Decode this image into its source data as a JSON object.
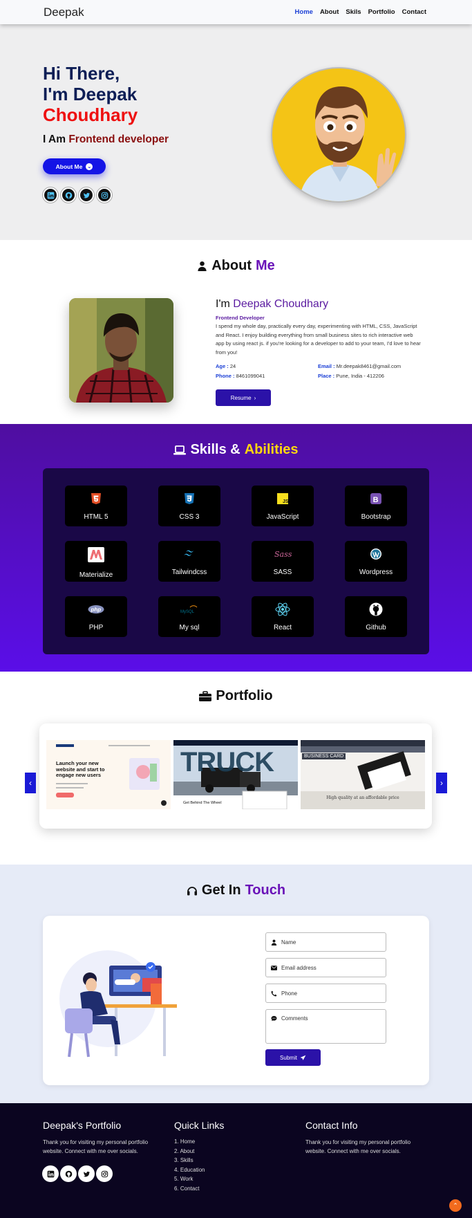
{
  "nav": {
    "brand": "Deepak",
    "links": [
      "Home",
      "About",
      "Skils",
      "Portfolio",
      "Contact"
    ],
    "active": "Home"
  },
  "hero": {
    "line1": "Hi There,",
    "line2": "I'm Deepak",
    "line3": "Choudhary",
    "subtitle_prefix": "I Am ",
    "subtitle_role": "Frontend developer",
    "button_label": "About Me",
    "socials": [
      "linkedin-icon",
      "github-icon",
      "twitter-icon",
      "instagram-icon"
    ]
  },
  "about": {
    "title_a": "About",
    "title_b": "Me",
    "name_prefix": "I'm ",
    "name": "Deepak Choudhary",
    "role": "Frontend Developer",
    "description": "I spend my whole day, practically every day, experimenting with HTML, CSS, JavaScript and React. I enjoy building everything from small business sites to rich interactive web app by using react js. if you're looking for a developer to add to your team, I'd love to hear from you!",
    "age_label": "Age :",
    "age": " 24",
    "phone_label": "Phone :",
    "phone": " 8461099041",
    "email_label": "Email :",
    "email": " Mr.deepak8461@gmail.com",
    "place_label": "Place :",
    "place": " Pune, India - 412206",
    "resume_label": "Resume"
  },
  "skills": {
    "title_a": "Skills &",
    "title_b": "Abilities",
    "items": [
      {
        "label": "HTML 5",
        "icon": "html5-icon",
        "color": "#e34f26"
      },
      {
        "label": "CSS 3",
        "icon": "css3-icon",
        "color": "#1572b6"
      },
      {
        "label": "JavaScript",
        "icon": "javascript-icon",
        "color": "#f7df1e"
      },
      {
        "label": "Bootstrap",
        "icon": "bootstrap-icon",
        "color": "#7952b3"
      },
      {
        "label": "Materialize",
        "icon": "materialize-icon",
        "color": "#ee6e73"
      },
      {
        "label": "Tailwindcss",
        "icon": "tailwind-icon",
        "color": "#38bdf8"
      },
      {
        "label": "SASS",
        "icon": "sass-icon",
        "color": "#cc6699"
      },
      {
        "label": "Wordpress",
        "icon": "wordpress-icon",
        "color": "#21759b"
      },
      {
        "label": "PHP",
        "icon": "php-icon",
        "color": "#8892bf"
      },
      {
        "label": "My sql",
        "icon": "mysql-icon",
        "color": "#00758f"
      },
      {
        "label": "React",
        "icon": "react-icon",
        "color": "#61dafb"
      },
      {
        "label": "Github",
        "icon": "github-icon",
        "color": "#ffffff"
      }
    ]
  },
  "portfolio": {
    "title": "Portfolio",
    "shot1_heading": "Launch your new website and start to engage new users",
    "shot2_word": "TRUCK",
    "shot2_caption": "Get Behind The Wheel",
    "shot3_tag": "BUSINESS CARD",
    "shot3_caption": "High quality at an affordable price",
    "prev": "‹",
    "next": "›"
  },
  "contact": {
    "title_a": "Get In",
    "title_b": "Touch",
    "name_placeholder": "Name",
    "email_placeholder": "Email address",
    "phone_placeholder": "Phone",
    "comments_placeholder": "Comments",
    "submit_label": "Submit"
  },
  "footer": {
    "col1_title": "Deepak's Portfolio",
    "col1_text": "Thank you for visiting my personal portfolio website. Connect with me over socials.",
    "col2_title": "Quick Links",
    "links": [
      "1. Home",
      "2. About",
      "3. Skills",
      "4. Education",
      "5. Work",
      "6. Contact"
    ],
    "col3_title": "Contact Info",
    "col3_text": "Thank you for visiting my personal portfolio website. Connect with me over socials.",
    "totop": "⌃"
  }
}
